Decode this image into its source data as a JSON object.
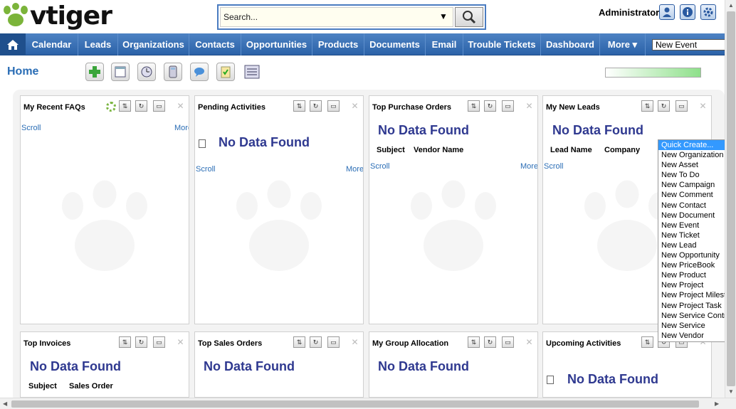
{
  "app": {
    "logo_text": "vtiger"
  },
  "search": {
    "placeholder": "Search...",
    "value": "Search..."
  },
  "user": {
    "name": "Administrator"
  },
  "nav": {
    "items": [
      "Calendar",
      "Leads",
      "Organizations",
      "Contacts",
      "Opportunities",
      "Products",
      "Documents",
      "Email",
      "Trouble Tickets",
      "Dashboard",
      "More ▾"
    ],
    "new_event": "New Event"
  },
  "home": {
    "title": "Home"
  },
  "widgets": [
    {
      "title": "My Recent FAQs",
      "scroll": "Scroll",
      "more": "More"
    },
    {
      "title": "Pending Activities",
      "nodata": "No Data Found",
      "scroll": "Scroll",
      "more": "More"
    },
    {
      "title": "Top Purchase Orders",
      "nodata": "No Data Found",
      "cols": [
        "Subject",
        "Vendor Name"
      ],
      "scroll": "Scroll",
      "more": "More"
    },
    {
      "title": "My New Leads",
      "nodata": "No Data Found",
      "cols": [
        "Lead Name",
        "Company"
      ],
      "scroll": "Scroll"
    },
    {
      "title": "Top Invoices",
      "nodata": "No Data Found",
      "cols": [
        "Subject",
        "Sales Order"
      ]
    },
    {
      "title": "Top Sales Orders",
      "nodata": "No Data Found"
    },
    {
      "title": "My Group Allocation",
      "nodata": "No Data Found"
    },
    {
      "title": "Upcoming Activities",
      "nodata": "No Data Found"
    }
  ],
  "quick_create": {
    "items": [
      "Quick Create...",
      "New Organization",
      "New Asset",
      "New To Do",
      "New Campaign",
      "New Comment",
      "New Contact",
      "New Document",
      "New Event",
      "New Ticket",
      "New Lead",
      "New Opportunity",
      "New PriceBook",
      "New Product",
      "New Project",
      "New Project Milestone",
      "New Project Task",
      "New Service Contract",
      "New Service",
      "New Vendor"
    ],
    "selected_index": 0
  },
  "colors": {
    "nav_bg": "#2b62a8",
    "link": "#2a6db5",
    "nodata": "#2f3990",
    "menu_selected": "#3399ff"
  },
  "icons": [
    "home-icon",
    "search-icon",
    "user-icon",
    "info-icon",
    "gear-icon"
  ]
}
